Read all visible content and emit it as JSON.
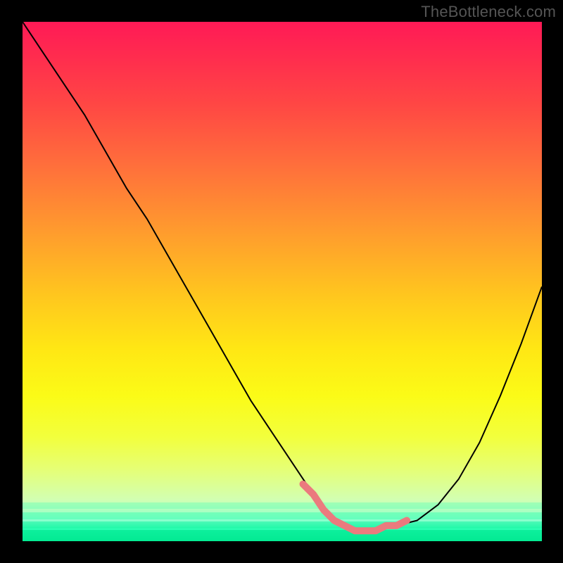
{
  "watermark": "TheBottleneck.com",
  "chart_data": {
    "type": "line",
    "title": "",
    "xlabel": "",
    "ylabel": "",
    "xlim": [
      0,
      100
    ],
    "ylim": [
      0,
      100
    ],
    "grid": false,
    "legend": false,
    "series": [
      {
        "name": "bottleneck-curve",
        "color": "#000000",
        "x": [
          0,
          4,
          8,
          12,
          16,
          20,
          24,
          28,
          32,
          36,
          40,
          44,
          48,
          52,
          56,
          58,
          60,
          62,
          64,
          66,
          68,
          72,
          76,
          80,
          84,
          88,
          92,
          96,
          100
        ],
        "y": [
          100,
          94,
          88,
          82,
          75,
          68,
          62,
          55,
          48,
          41,
          34,
          27,
          21,
          15,
          9,
          6,
          4,
          3,
          2,
          2,
          2,
          3,
          4,
          7,
          12,
          19,
          28,
          38,
          49
        ]
      }
    ],
    "highlight": {
      "name": "optimal-range-marker",
      "color": "#eb7a7e",
      "x": [
        54,
        56,
        58,
        60,
        62,
        64,
        66,
        68,
        70,
        72,
        74
      ],
      "y": [
        11,
        9,
        6,
        4,
        3,
        2,
        2,
        2,
        3,
        3,
        4
      ]
    },
    "gradient_stops": [
      {
        "pos": 0.0,
        "color": "#ff1a56"
      },
      {
        "pos": 0.28,
        "color": "#ff703b"
      },
      {
        "pos": 0.52,
        "color": "#ffc41f"
      },
      {
        "pos": 0.72,
        "color": "#fbfb17"
      },
      {
        "pos": 0.92,
        "color": "#d2ffb2"
      },
      {
        "pos": 1.0,
        "color": "#07f59a"
      }
    ]
  }
}
